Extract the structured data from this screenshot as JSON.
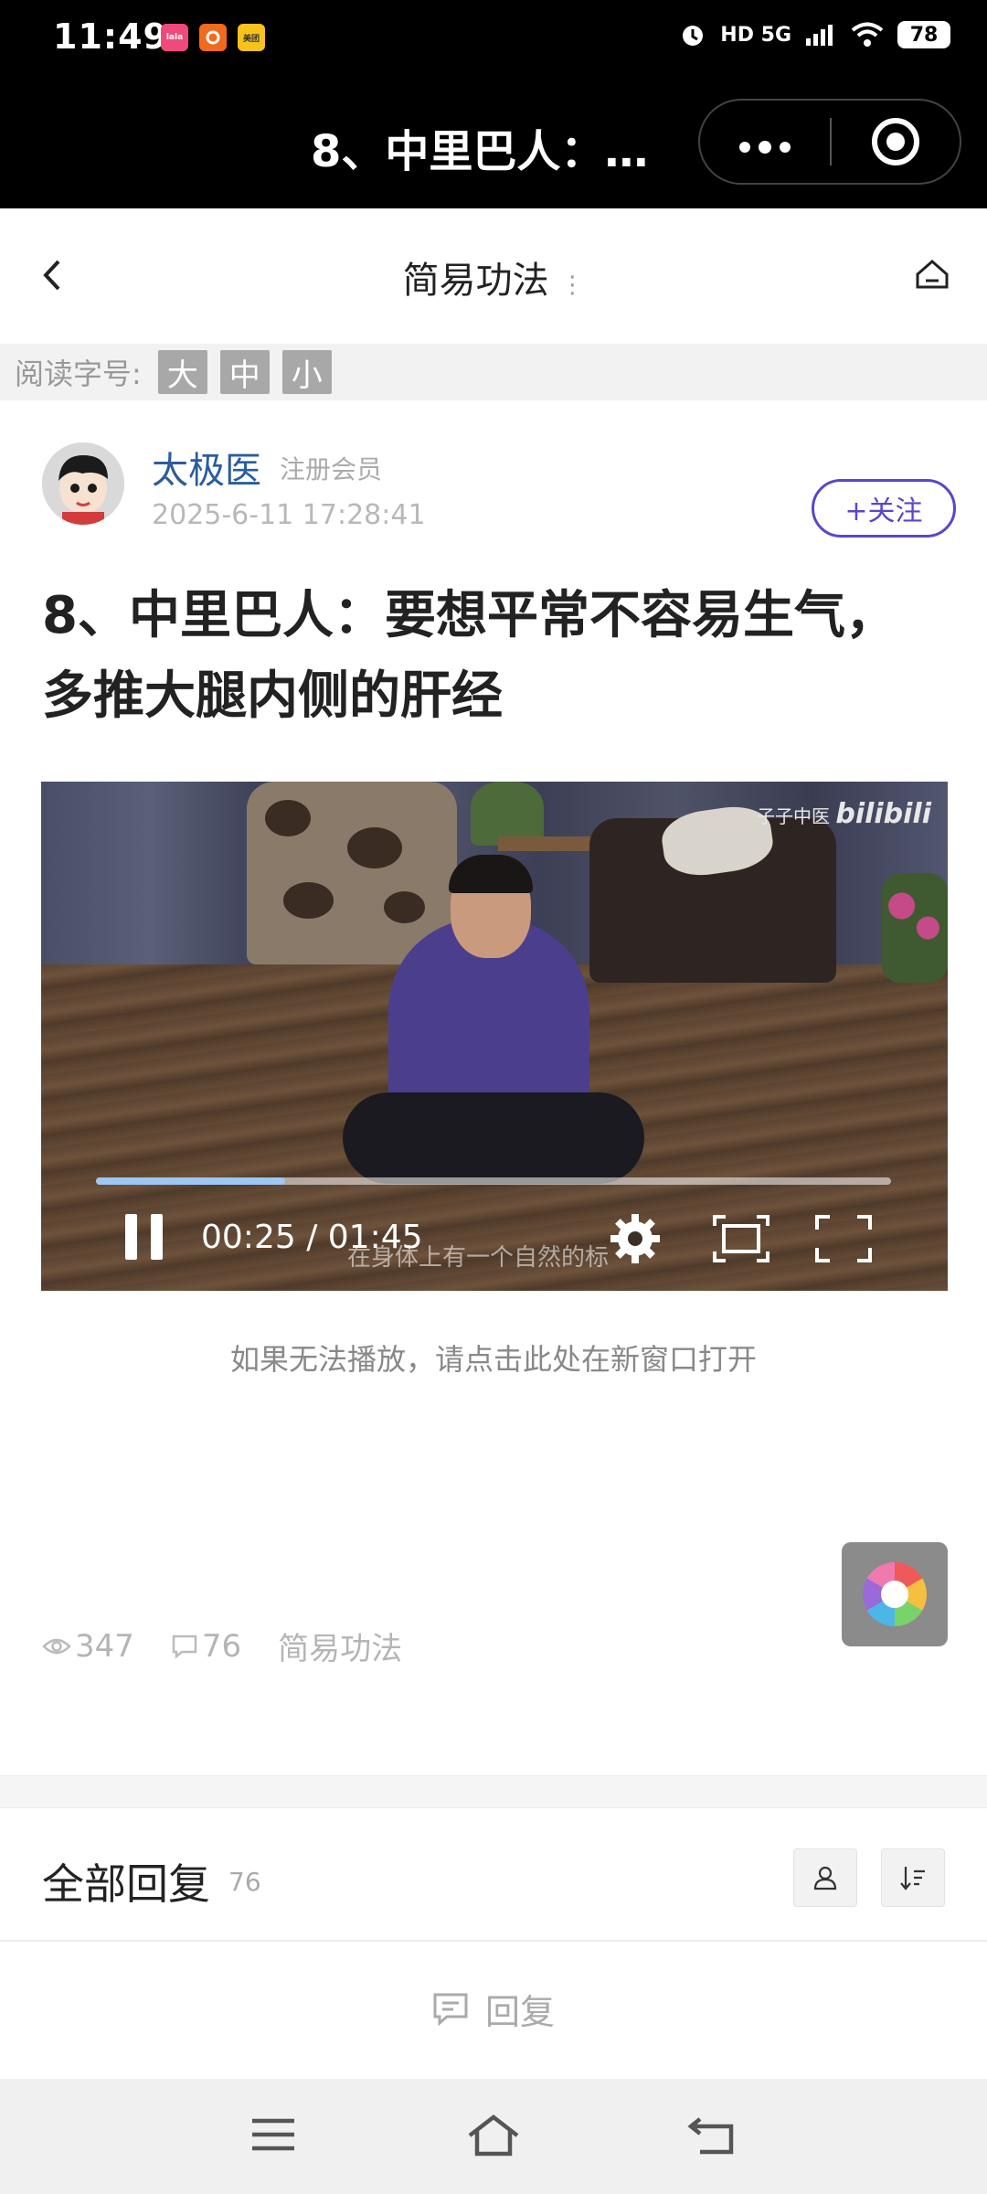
{
  "status_bar": {
    "time": "11:49",
    "app_icons": [
      {
        "name": "lala-icon",
        "label": "lala",
        "color": "#f04a7a"
      },
      {
        "name": "app-orange-icon",
        "label": "",
        "color": "#f26a1b"
      },
      {
        "name": "meituan-icon",
        "label": "美团",
        "color": "#f7c21a"
      }
    ],
    "indicators": "HD 5G",
    "battery": "78"
  },
  "mini_program": {
    "title": "8、中里巴人：…"
  },
  "navbar": {
    "title": "简易功法"
  },
  "font_size_bar": {
    "label": "阅读字号:",
    "options": [
      "大",
      "中",
      "小"
    ]
  },
  "author": {
    "name": "太极医",
    "role": "注册会员",
    "posted_at": "2025-6-11 17:28:41",
    "follow_label": "+关注"
  },
  "article": {
    "title": "8、中里巴人：要想平常不容易生气，多推大腿内侧的肝经"
  },
  "video": {
    "watermark_text": "子子中医",
    "watermark_brand": "bilibili",
    "time_display": "00:25 / 01:45",
    "subtitle": "在身体上有一个自然的标",
    "progress": 0.238
  },
  "open_link": "如果无法播放，请点击此处在新窗口打开",
  "meta": {
    "views": "347",
    "comments": "76",
    "category": "简易功法"
  },
  "replies": {
    "title": "全部回复",
    "count": "76",
    "reply_label": "回复"
  },
  "colors": {
    "accent": "#5c46c8",
    "author_link": "#2a5d9c",
    "progress_fill": "#9ec7f2"
  }
}
